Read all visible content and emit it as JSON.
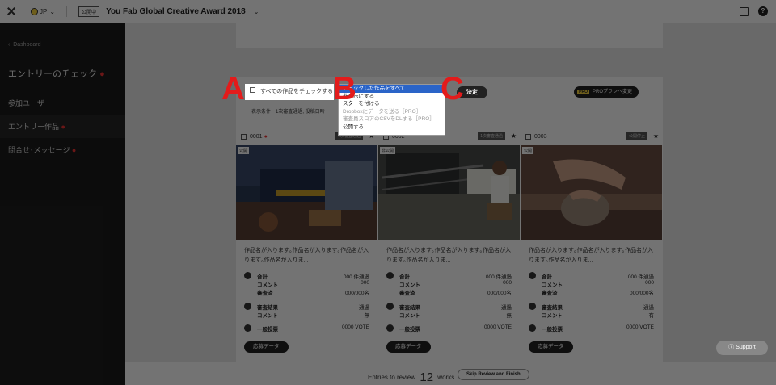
{
  "topbar": {
    "lang": "JP",
    "badge": "公開中",
    "event_title": "You Fab Global Creative Award 2018"
  },
  "sidebar": {
    "back": "Dashboard",
    "heading": "エントリーのチェック",
    "items": [
      {
        "label": "参加ユーザー",
        "required": false
      },
      {
        "label": "エントリー作品",
        "required": true
      },
      {
        "label": "問合せ･メッセージ",
        "required": true
      }
    ]
  },
  "panel": {
    "pro_tag": "PRO",
    "pro_label": "PROプランへ変更",
    "condition": "表示条件：1次審査通過, 投稿日時"
  },
  "toolbar": {
    "check_all_label": "すべての作品をチェックする",
    "decide_label": "決定"
  },
  "dropdown": {
    "items": [
      {
        "label": "チェックした作品をすべて",
        "state": "selected"
      },
      {
        "label": "非表示にする",
        "state": "normal"
      },
      {
        "label": "スターを付ける",
        "state": "normal"
      },
      {
        "label": "Dropboxにデータを送る［PRO］",
        "state": "disabled"
      },
      {
        "label": "審査員スコアのCSVをDLする［PRO］",
        "state": "disabled"
      },
      {
        "label": "公開する",
        "state": "normal"
      }
    ]
  },
  "labels": {
    "a": "A",
    "b": "B",
    "c": "C"
  },
  "cards": [
    {
      "id": "0001",
      "has_dot": true,
      "status": "1次審査通過",
      "photo_badge": "公開",
      "title": "作品名が入ります｡作品名が入ります｡作品名が入ります｡作品名が入りま...",
      "total_label": "合計",
      "total_value": "000 件通過",
      "comment_label": "コメント",
      "comment_value": "000",
      "reviewed_label": "審査済",
      "reviewed_value": "000/000名",
      "result_label": "審査結果",
      "result_value": "通過",
      "comment2_label": "コメント",
      "comment2_value": "無",
      "vote_label": "一般投票",
      "vote_value": "0000 VOTE",
      "data_btn": "応募データ"
    },
    {
      "id": "0002",
      "has_dot": false,
      "status": "1次審査通過",
      "photo_badge": "非公開",
      "title": "作品名が入ります｡作品名が入ります｡作品名が入ります｡作品名が入りま...",
      "total_label": "合計",
      "total_value": "000 件通過",
      "comment_label": "コメント",
      "comment_value": "000",
      "reviewed_label": "審査済",
      "reviewed_value": "000/000名",
      "result_label": "審査結果",
      "result_value": "通過",
      "comment2_label": "コメント",
      "comment2_value": "無",
      "vote_label": "一般投票",
      "vote_value": "0000 VOTE",
      "data_btn": "応募データ"
    },
    {
      "id": "0003",
      "has_dot": false,
      "status": "公開停止",
      "photo_badge": "公開",
      "title": "作品名が入ります｡作品名が入ります｡作品名が入ります｡作品名が入りま...",
      "total_label": "合計",
      "total_value": "000 件通過",
      "comment_label": "コメント",
      "comment_value": "000",
      "reviewed_label": "審査済",
      "reviewed_value": "000/000名",
      "result_label": "審査結果",
      "result_value": "通過",
      "comment2_label": "コメント",
      "comment2_value": "有",
      "vote_label": "一般投票",
      "vote_value": "0000 VOTE",
      "data_btn": "応募データ"
    }
  ],
  "bottom": {
    "entries_prefix": "Entries to review",
    "count": "12",
    "entries_suffix": "works",
    "skip_label": "Skip Review and Finish"
  },
  "support_label": "Support"
}
